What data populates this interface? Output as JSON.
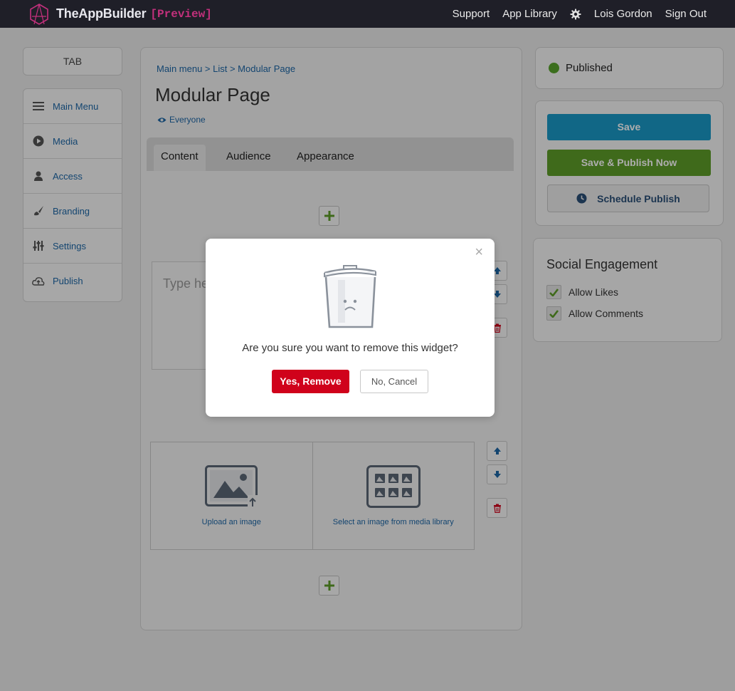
{
  "header": {
    "brand": "TheAppBuilder",
    "badge": "[Preview]",
    "nav": {
      "support": "Support",
      "app_library": "App Library",
      "user": "Lois Gordon",
      "sign_out": "Sign Out"
    }
  },
  "sidebar": {
    "tab_label": "TAB",
    "items": [
      {
        "label": "Main Menu",
        "icon": "hamburger-icon"
      },
      {
        "label": "Media",
        "icon": "play-icon"
      },
      {
        "label": "Access",
        "icon": "person-icon"
      },
      {
        "label": "Branding",
        "icon": "brush-icon"
      },
      {
        "label": "Settings",
        "icon": "sliders-icon"
      },
      {
        "label": "Publish",
        "icon": "cloud-upload-icon"
      }
    ]
  },
  "main": {
    "breadcrumb": "Main menu > List > Modular Page",
    "title": "Modular Page",
    "audience": "Everyone",
    "tabs": [
      "Content",
      "Audience",
      "Appearance"
    ],
    "active_tab": "Content",
    "text_placeholder": "Type he",
    "upload_label": "Upload an image",
    "library_label": "Select an image from media library"
  },
  "status": {
    "label": "Published",
    "color": "#58a22c"
  },
  "actions": {
    "save": "Save",
    "publish_now": "Save & Publish Now",
    "schedule": "Schedule Publish"
  },
  "social": {
    "title": "Social Engagement",
    "options": [
      {
        "label": "Allow Likes",
        "checked": true
      },
      {
        "label": "Allow Comments",
        "checked": true
      }
    ]
  },
  "modal": {
    "message": "Are you sure you want to remove this widget?",
    "confirm": "Yes, Remove",
    "cancel": "No, Cancel",
    "close": "×"
  },
  "colors": {
    "primary": "#1a98c6",
    "success": "#5e9c28",
    "danger": "#d0021b",
    "link": "#1d66a6",
    "brand_badge": "#c2307c"
  }
}
